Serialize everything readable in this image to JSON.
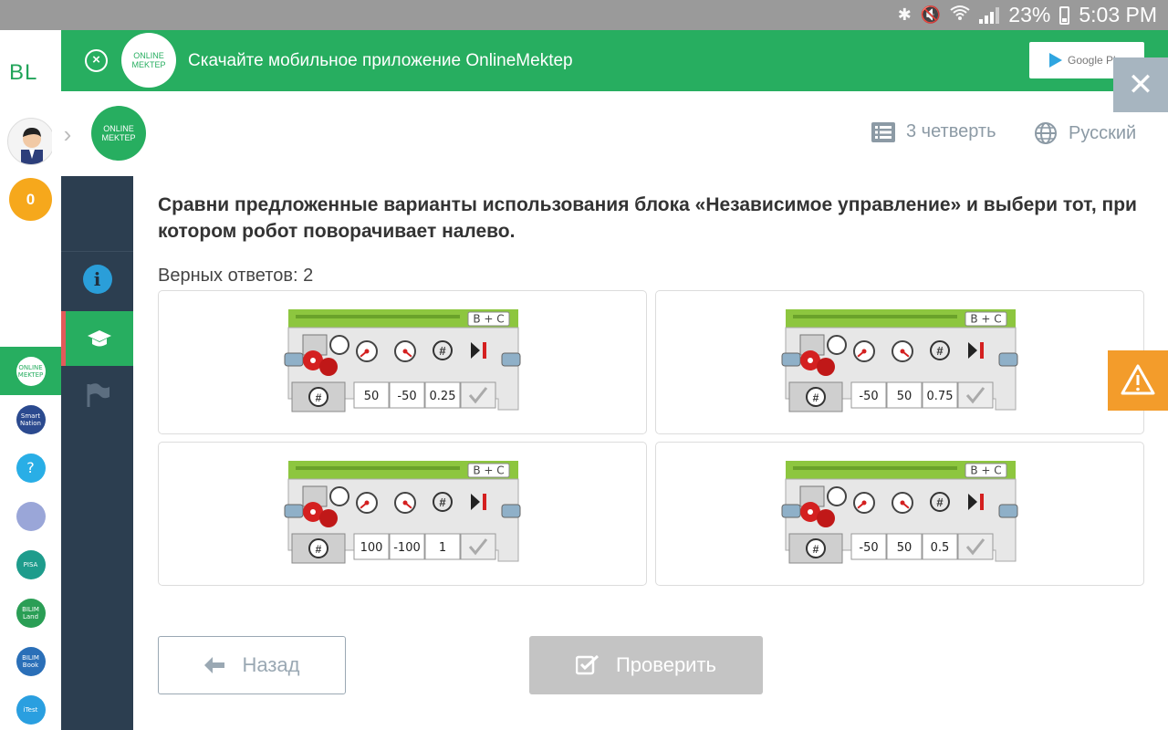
{
  "status_bar": {
    "battery": "23%",
    "time": "5:03 PM"
  },
  "rail": {
    "logo": "BL",
    "coins": "0",
    "apps": [
      {
        "name": "ONLINE MEKTEP",
        "color": "#27ae60"
      },
      {
        "name": "Smart Nation",
        "color": "#2b4a8f"
      },
      {
        "name": "?",
        "color": "#29aee6"
      },
      {
        "name": "",
        "color": "#9aa6d8"
      },
      {
        "name": "PISA",
        "color": "#1e9c8c"
      },
      {
        "name": "BILIM Land",
        "color": "#2a9e55"
      },
      {
        "name": "BILIM Book",
        "color": "#2a6fb8"
      },
      {
        "name": "iTest",
        "color": "#2a9fe0"
      }
    ]
  },
  "banner": {
    "logo_text": "ONLINE MEKTEP",
    "text": "Скачайте мобильное приложение OnlineMektep",
    "store": "Google Play"
  },
  "sidebar": {
    "logo_text": "ONLINE MEKTEP"
  },
  "header": {
    "quarter": "3 четверть",
    "language": "Русский"
  },
  "question": {
    "text": "Сравни предложенные варианты использования блока «Независимое управление» и выбери тот, при котором робот поворачивает налево.",
    "correct_count": "Верных ответов: 2"
  },
  "options": [
    {
      "ports": "B + C",
      "left": "50",
      "right": "-50",
      "rotations": "0.25"
    },
    {
      "ports": "B + C",
      "left": "-50",
      "right": "50",
      "rotations": "0.75"
    },
    {
      "ports": "B + C",
      "left": "100",
      "right": "-100",
      "rotations": "1"
    },
    {
      "ports": "B + C",
      "left": "-50",
      "right": "50",
      "rotations": "0.5"
    }
  ],
  "buttons": {
    "back": "Назад",
    "check": "Проверить"
  },
  "colors": {
    "green": "#27ae60",
    "sidebar": "#2c3e50",
    "warning": "#f39c2b",
    "coin": "#f6a81c"
  }
}
